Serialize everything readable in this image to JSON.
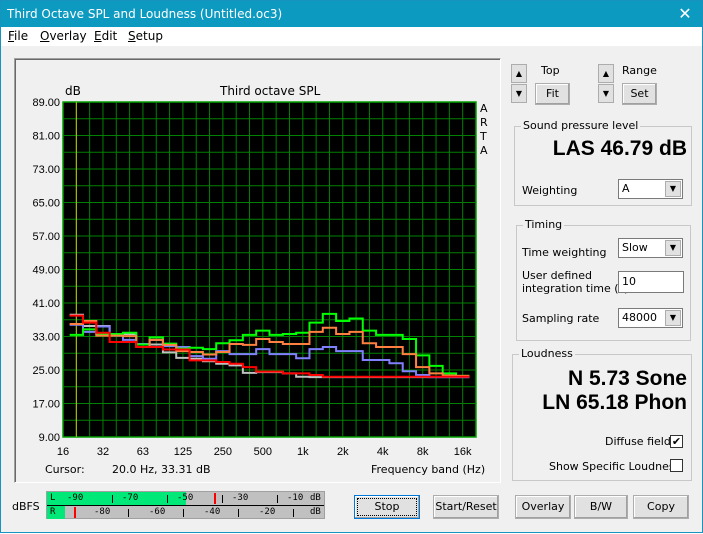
{
  "window": {
    "title": "Third Octave SPL and Loudness (Untitled.oc3)",
    "close_icon": "close-icon"
  },
  "menu": [
    {
      "label": "File",
      "key": "F"
    },
    {
      "label": "Overlay",
      "key": "O"
    },
    {
      "label": "Edit",
      "key": "E"
    },
    {
      "label": "Setup",
      "key": "S"
    }
  ],
  "chart_data": {
    "type": "line",
    "step": true,
    "title": "Third octave SPL",
    "ylabel": "dB",
    "xlabel": "Frequency band (Hz)",
    "side_label": [
      "A",
      "R",
      "T",
      "A"
    ],
    "ylim": [
      9,
      89
    ],
    "yticks": [
      "89.00",
      "81.00",
      "73.00",
      "65.00",
      "57.00",
      "49.00",
      "41.00",
      "33.00",
      "25.00",
      "17.00",
      "9.00"
    ],
    "xticks": [
      "16",
      "32",
      "63",
      "125",
      "250",
      "500",
      "1k",
      "2k",
      "4k",
      "8k",
      "16k"
    ],
    "grid": true,
    "background": "#000000",
    "grid_color": "#008000",
    "x": [
      "20",
      "25",
      "31.5",
      "40",
      "50",
      "63",
      "80",
      "100",
      "125",
      "160",
      "200",
      "250",
      "315",
      "400",
      "500",
      "630",
      "800",
      "1k",
      "1.25k",
      "1.6k",
      "2k",
      "2.5k",
      "3.15k",
      "4k",
      "5k",
      "6.3k",
      "8k",
      "10k",
      "12.5k",
      "16k"
    ],
    "series": [
      {
        "color": "#c0c0c0",
        "values": [
          38.2,
          35.5,
          35.5,
          33.6,
          33.6,
          31.2,
          31.1,
          29.2,
          27.9,
          27.7,
          27.1,
          26.5,
          26.1,
          24.3,
          24.5,
          24.5,
          24.2,
          23.4,
          23.3,
          23.3,
          23.3,
          23.3,
          23.3,
          23.3,
          23.3,
          23.3,
          23.3,
          23.3,
          23.3,
          23.3
        ]
      },
      {
        "color": "#8080ff",
        "values": [
          35.8,
          34.1,
          35.4,
          33.2,
          32.2,
          31.2,
          32.2,
          30.7,
          30.5,
          28.3,
          27.7,
          29.5,
          28.8,
          28.8,
          30.0,
          28.8,
          28.8,
          27.8,
          30.0,
          30.5,
          29.5,
          29.5,
          27.4,
          27.4,
          26.6,
          24.7,
          23.8,
          23.3,
          23.3,
          23.3
        ]
      },
      {
        "color": "#00ff00",
        "values": [
          33.4,
          34.7,
          33.6,
          33.6,
          33.9,
          31.1,
          32.8,
          31.3,
          30.1,
          30.3,
          30.0,
          31.4,
          32.1,
          33.4,
          34.4,
          33.4,
          33.6,
          33.9,
          36.3,
          38.4,
          36.7,
          37.3,
          34.4,
          33.4,
          33.4,
          32.4,
          28.5,
          26.0,
          24.2,
          23.6
        ]
      },
      {
        "color": "#ff8040",
        "values": [
          36.0,
          36.7,
          33.2,
          33.2,
          33.1,
          30.5,
          32.2,
          31.0,
          29.5,
          29.3,
          28.7,
          29.3,
          31.2,
          31.0,
          32.4,
          31.7,
          31.2,
          31.2,
          34.1,
          35.1,
          33.6,
          34.1,
          31.4,
          30.5,
          30.5,
          28.8,
          25.7,
          24.2,
          23.7,
          23.6
        ]
      },
      {
        "color": "#ff0000",
        "values": [
          38.0,
          36.3,
          33.9,
          31.7,
          31.7,
          30.5,
          30.5,
          29.9,
          29.9,
          27.3,
          27.3,
          26.9,
          26.5,
          25.7,
          24.6,
          24.6,
          24.2,
          24.2,
          23.8,
          23.4,
          23.4,
          23.4,
          23.4,
          23.4,
          23.4,
          23.4,
          23.4,
          23.4,
          23.4,
          23.4
        ]
      }
    ],
    "cursor": {
      "label": "Cursor:",
      "value": "20.0 Hz, 33.31 dB",
      "freq": 20,
      "color": "#c8c800"
    }
  },
  "scale_controls": {
    "top_label": "Top",
    "fit_label": "Fit",
    "range_label": "Range",
    "set_label": "Set"
  },
  "spl": {
    "legend": "Sound pressure level",
    "value": "LAS 46.79 dB",
    "weighting_label": "Weighting",
    "weighting_value": "A"
  },
  "timing": {
    "legend": "Timing",
    "time_weighting_label": "Time weighting",
    "time_weighting_value": "Slow",
    "integration_label_1": "User defined",
    "integration_label_2": "integration time (s)",
    "integration_value": "10",
    "sampling_label": "Sampling rate",
    "sampling_value": "48000"
  },
  "loudness": {
    "legend": "Loudness",
    "n": "N 5.73 Sone",
    "ln": "LN 65.18 Phon",
    "diffuse_label": "Diffuse field",
    "diffuse_checked": true,
    "specific_label": "Show Specific Loudness",
    "specific_checked": false
  },
  "meter": {
    "label": "dBFS",
    "l_label": "L",
    "r_label": "R",
    "l_ticks": [
      "-90",
      "-70",
      "-50",
      "-30",
      "-10"
    ],
    "r_ticks": [
      "-80",
      "-60",
      "-40",
      "-20"
    ],
    "unit": "dB",
    "l_level_dbfs": -47,
    "l_peak_dbfs": -36,
    "r_level_dbfs": -97,
    "r_peak_dbfs": -95,
    "fill_color": "#00e878",
    "peak_color": "#ff0000"
  },
  "buttons": {
    "stop": "Stop",
    "start_reset": "Start/Reset",
    "overlay": "Overlay",
    "bw": "B/W",
    "copy": "Copy"
  }
}
